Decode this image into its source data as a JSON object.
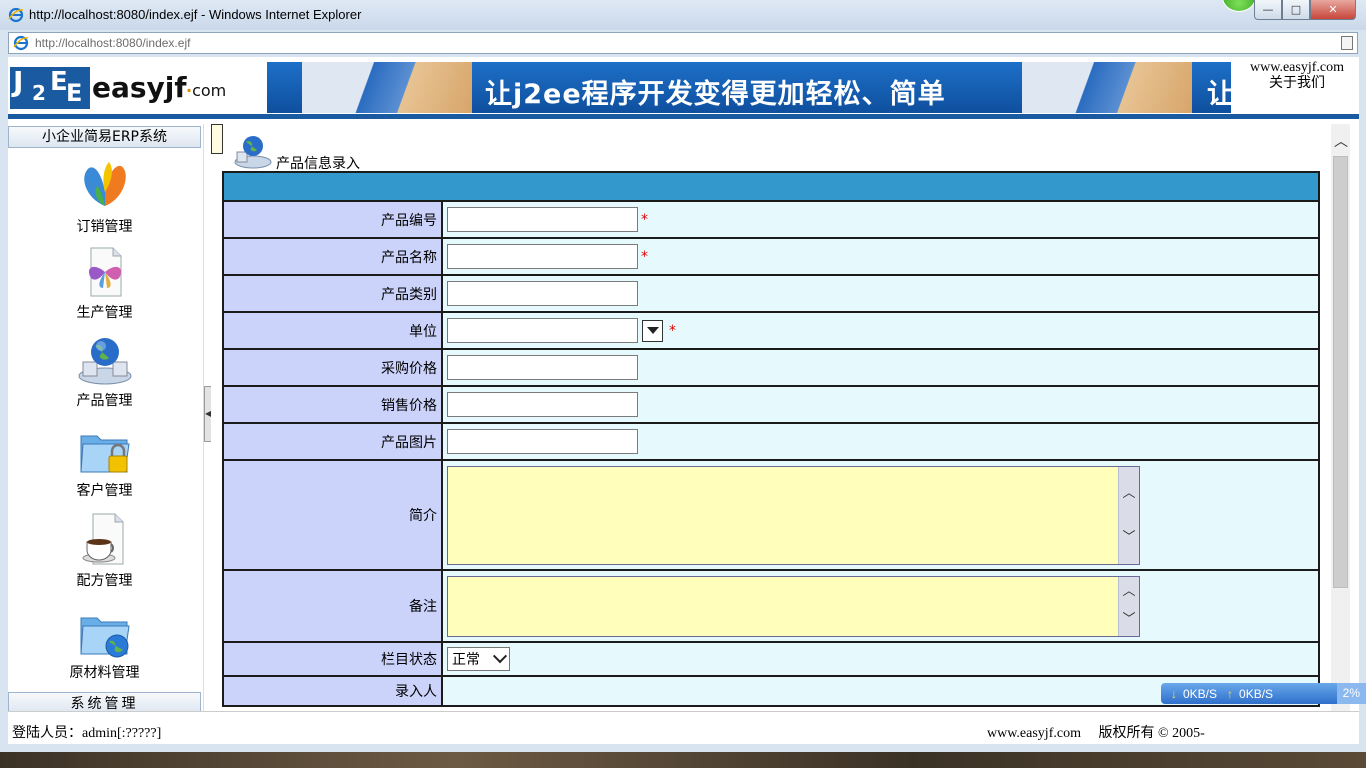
{
  "window": {
    "title": "http://localhost:8080/index.ejf - Windows Internet Explorer",
    "url": "http://localhost:8080/index.ejf",
    "buttons": {
      "minimize": "—",
      "maximize": "□",
      "close": "✕"
    }
  },
  "header": {
    "logo_brand": "easyjf",
    "logo_com": "com",
    "logo_j": "J",
    "logo_2": "2",
    "logo_e": "E",
    "banner_slogan": "让j2ee程序开发变得更加轻松、简单",
    "banner_slogan_clip": "让",
    "site": "www.easyjf.com",
    "about": "关于我们"
  },
  "sidebar": {
    "title": "小企业简易ERP系统",
    "items": [
      {
        "label": "订销管理",
        "icon": "butterfly-logo-icon"
      },
      {
        "label": "生产管理",
        "icon": "butterfly-document-icon"
      },
      {
        "label": "产品管理",
        "icon": "globe-network-icon"
      },
      {
        "label": "客户管理",
        "icon": "locked-folder-icon"
      },
      {
        "label": "配方管理",
        "icon": "coffee-document-icon"
      },
      {
        "label": "原材料管理",
        "icon": "globe-folder-icon"
      }
    ],
    "bottom": "系统管理"
  },
  "content": {
    "page_title": "产品信息录入",
    "required_mark": "*",
    "fields": {
      "code": "产品编号",
      "name": "产品名称",
      "category": "产品类别",
      "unit": "单位",
      "purchase_price": "采购价格",
      "sale_price": "销售价格",
      "image": "产品图片",
      "intro": "简介",
      "remark": "备注",
      "status": "栏目状态",
      "entered_by": "录入人"
    },
    "status_value": "正常"
  },
  "footer": {
    "login": "登陆人员：admin[:?????]",
    "copyright": "www.easyjf.com　 版权所有 © 2005-"
  },
  "netmeter": {
    "down": "0KB/S",
    "up": "0KB/S",
    "pct": "2%"
  },
  "colors": {
    "label_bg": "#ccd3fb",
    "value_bg": "#e6fafd",
    "header_row": "#3399cc",
    "textarea_bg": "#ffffbb",
    "brand_blue": "#1a5aa0"
  }
}
